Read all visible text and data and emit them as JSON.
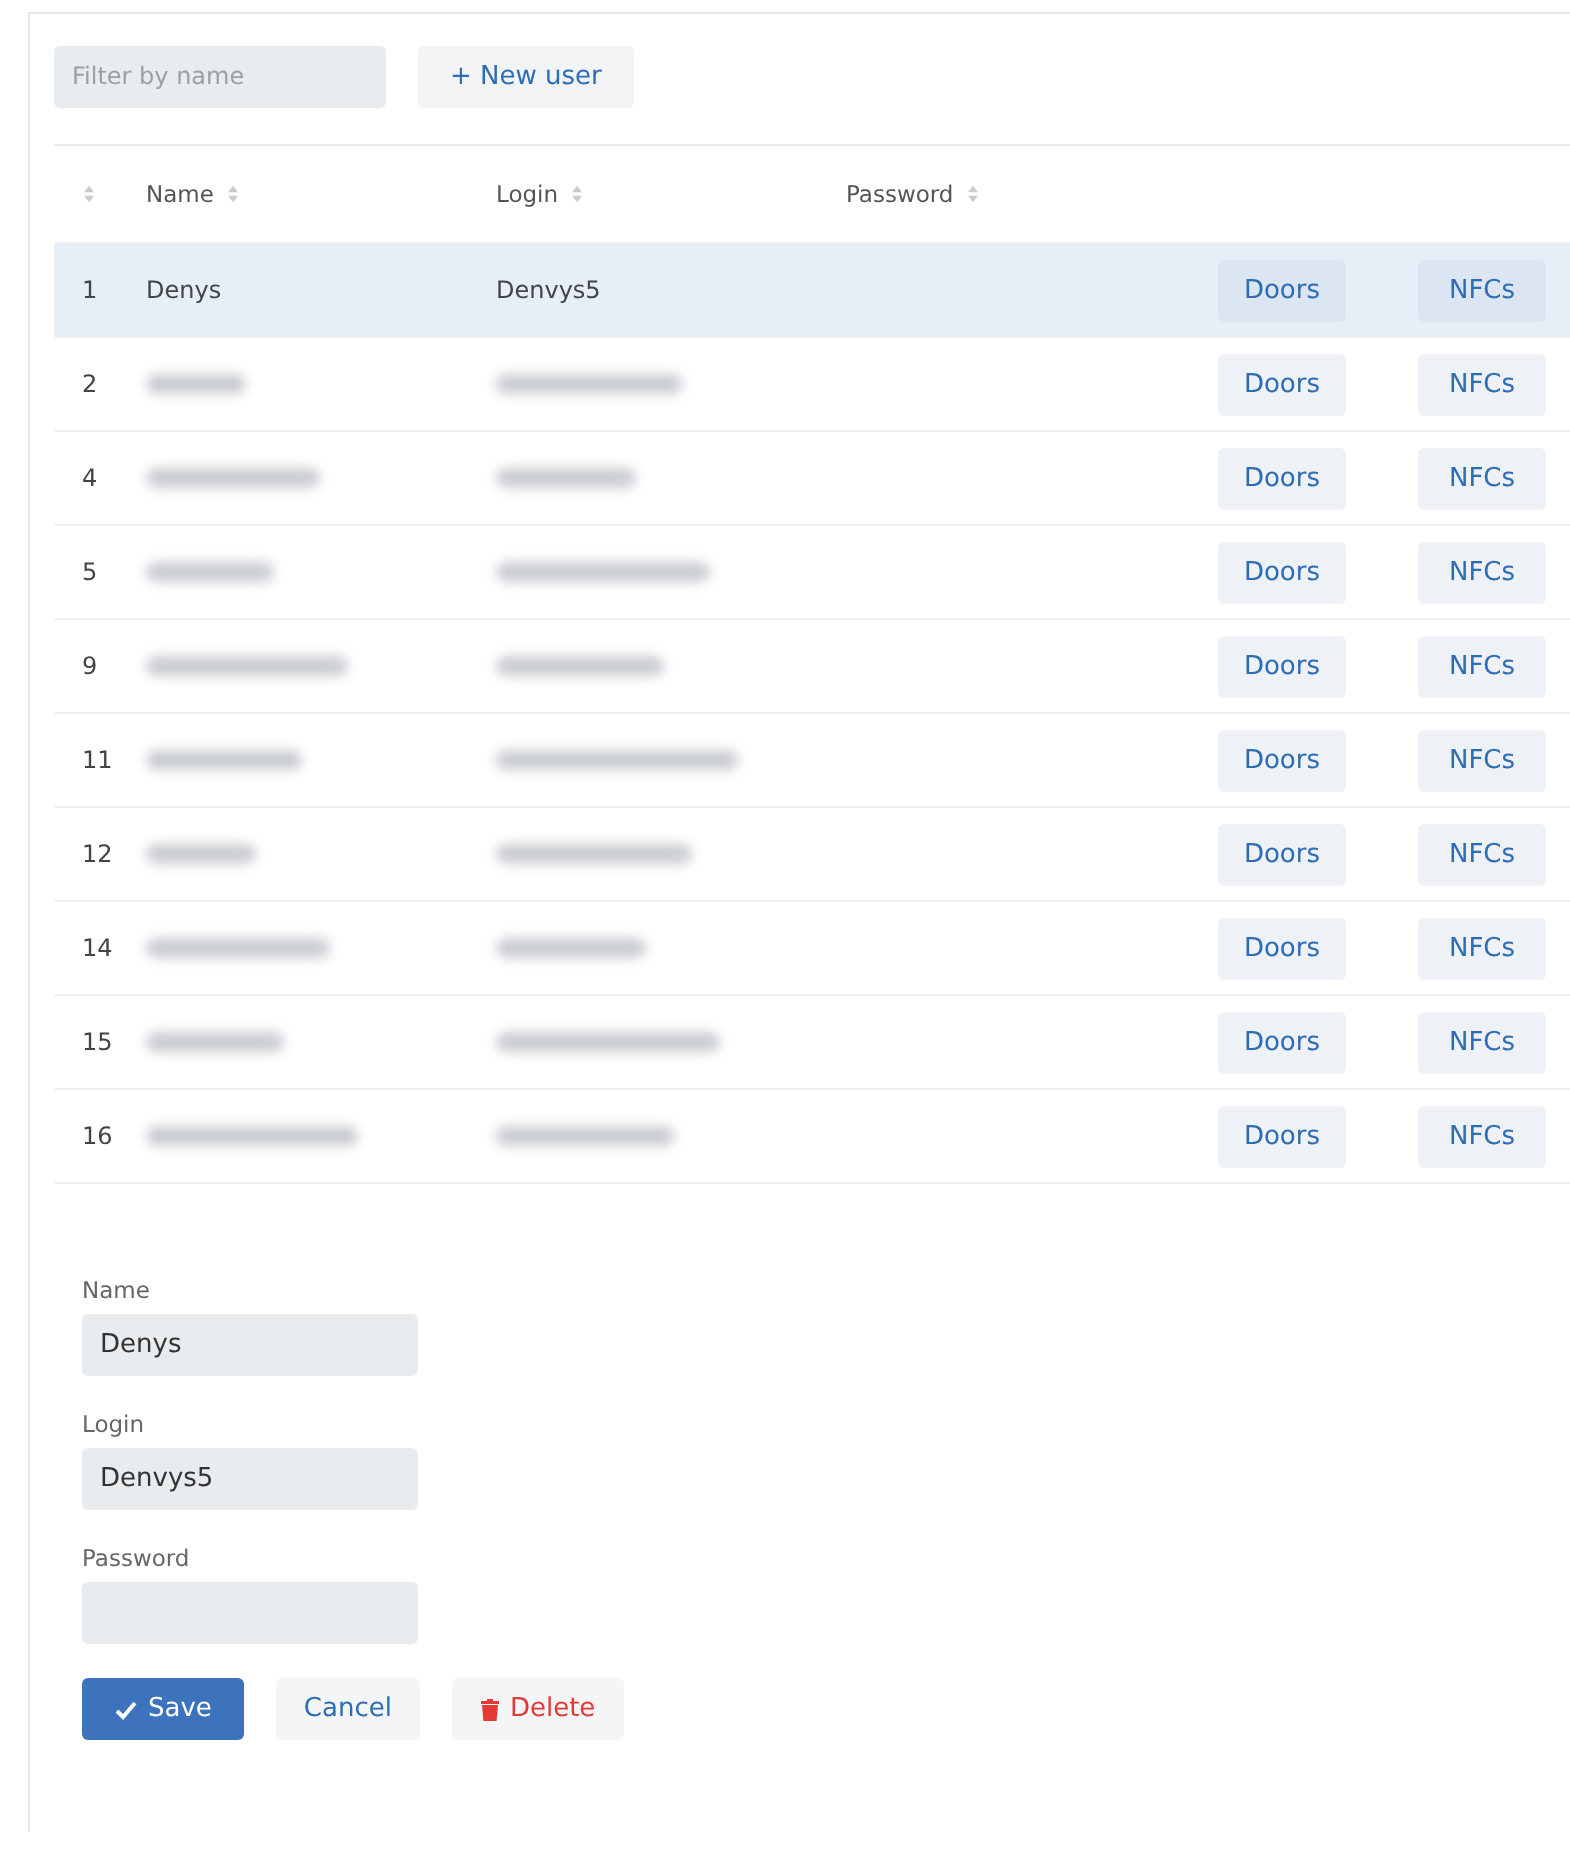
{
  "toolbar": {
    "filter": {
      "placeholder": "Filter by name"
    },
    "new_button": "+ New user"
  },
  "table": {
    "columns": [
      {
        "kind": "index"
      },
      {
        "label": "Name"
      },
      {
        "label": "Login"
      },
      {
        "label": "Password"
      }
    ],
    "rows": [
      {
        "id": "1",
        "name": "Denys",
        "login": "Denvys5",
        "blurred": false,
        "selected": true,
        "doors": "Doors",
        "nfcs": "NFCs"
      },
      {
        "id": "2",
        "blurred": true,
        "selected": false,
        "doors": "Doors",
        "nfcs": "NFCs"
      },
      {
        "id": "4",
        "blurred": true,
        "selected": false,
        "doors": "Doors",
        "nfcs": "NFCs"
      },
      {
        "id": "5",
        "blurred": true,
        "selected": false,
        "doors": "Doors",
        "nfcs": "NFCs"
      },
      {
        "id": "9",
        "blurred": true,
        "selected": false,
        "doors": "Doors",
        "nfcs": "NFCs"
      },
      {
        "id": "11",
        "blurred": true,
        "selected": false,
        "doors": "Doors",
        "nfcs": "NFCs"
      },
      {
        "id": "12",
        "blurred": true,
        "selected": false,
        "doors": "Doors",
        "nfcs": "NFCs"
      },
      {
        "id": "14",
        "blurred": true,
        "selected": false,
        "doors": "Doors",
        "nfcs": "NFCs"
      },
      {
        "id": "15",
        "blurred": true,
        "selected": false,
        "doors": "Doors",
        "nfcs": "NFCs"
      },
      {
        "id": "16",
        "blurred": true,
        "selected": false,
        "doors": "Doors",
        "nfcs": "NFCs"
      }
    ]
  },
  "form": {
    "fields": [
      {
        "label": "Name",
        "value": "Denys"
      },
      {
        "label": "Login",
        "value": "Denvys5"
      },
      {
        "label": "Password"
      }
    ],
    "buttons": [
      {
        "kind": "primary",
        "label": "Save"
      },
      {
        "kind": "plain",
        "label": "Cancel"
      },
      {
        "kind": "danger",
        "label": "Delete"
      }
    ]
  }
}
